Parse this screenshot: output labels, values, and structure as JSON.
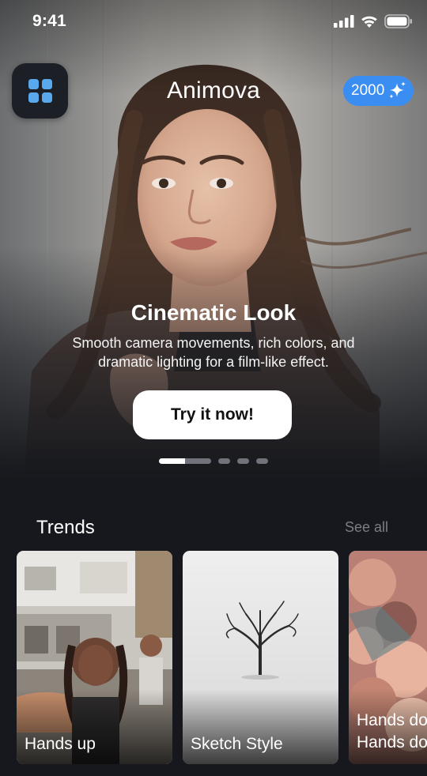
{
  "status_bar": {
    "time": "9:41"
  },
  "header": {
    "app_title": "Animova",
    "credits": "2000"
  },
  "hero": {
    "title": "Cinematic Look",
    "subtitle": "Smooth camera movements, rich colors, and dramatic lighting for a film-like effect.",
    "cta_label": "Try it now!",
    "carousel": {
      "active_index": 0,
      "count": 4
    }
  },
  "trends": {
    "section_title": "Trends",
    "see_all_label": "See all",
    "cards": [
      {
        "label": "Hands up"
      },
      {
        "label": "Sketch Style"
      },
      {
        "label_line1": "Hands do",
        "label_line2": "Hands do"
      }
    ]
  },
  "colors": {
    "background": "#16181d",
    "accent_blue": "#3a8ef2",
    "menu_icon_blue": "#5aa8ec",
    "muted_text": "#7b7e85"
  },
  "icons": [
    "grid-menu-icon",
    "sparkle-icon",
    "signal-icon",
    "wifi-icon",
    "battery-icon"
  ]
}
